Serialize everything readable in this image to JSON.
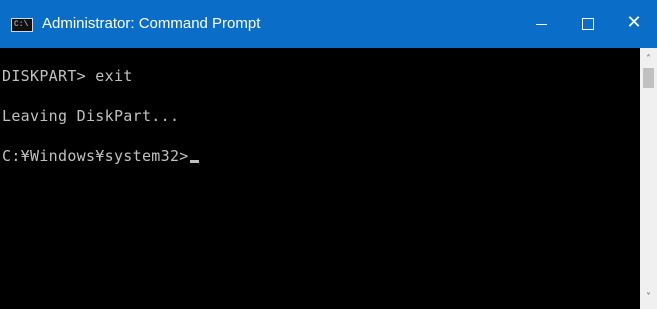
{
  "window": {
    "title": "Administrator: Command Prompt",
    "app_icon_text": "C:\\",
    "controls": {
      "minimize_icon": "minimize-icon",
      "maximize_icon": "maximize-icon",
      "close_icon": "close-icon",
      "close_glyph": "✕"
    },
    "accent_color": "#0a6dc8"
  },
  "console": {
    "lines": [
      "DISKPART> exit",
      "Leaving DiskPart...",
      "C:¥Windows¥system32>"
    ],
    "text_color": "#c0c0c0",
    "background": "#000000"
  },
  "scrollbar": {
    "up_glyph": "˄",
    "down_glyph": "˅"
  }
}
